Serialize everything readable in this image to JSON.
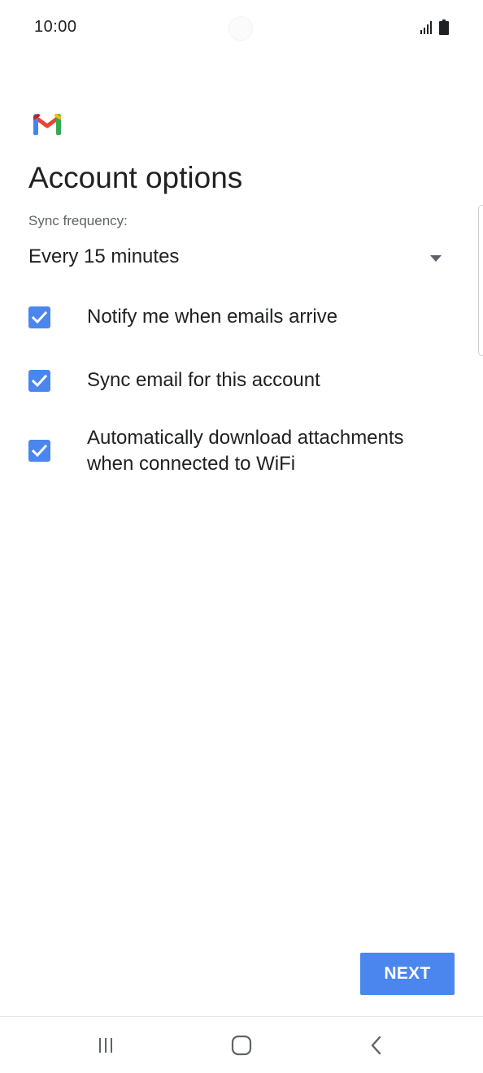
{
  "status_bar": {
    "time": "10:00",
    "icons": [
      "signal-icon",
      "battery-icon"
    ]
  },
  "app": {
    "logo": "gmail-logo",
    "colors": {
      "accent": "#4a86ed",
      "logo_red": "#ea4335",
      "logo_blue": "#4285f4",
      "logo_green": "#34a853",
      "logo_yellow": "#fbbc04"
    }
  },
  "header": {
    "title": "Account options"
  },
  "sync": {
    "label": "Sync frequency:",
    "selected_value": "Every 15 minutes"
  },
  "options": [
    {
      "label": "Notify me when emails arrive",
      "checked": true
    },
    {
      "label": "Sync email for this account",
      "checked": true
    },
    {
      "label": "Automatically download attachments when connected to WiFi",
      "checked": true
    }
  ],
  "footer": {
    "next_label": "NEXT"
  },
  "nav_bar": {
    "items": [
      "recent-apps-icon",
      "home-icon",
      "back-icon"
    ]
  }
}
